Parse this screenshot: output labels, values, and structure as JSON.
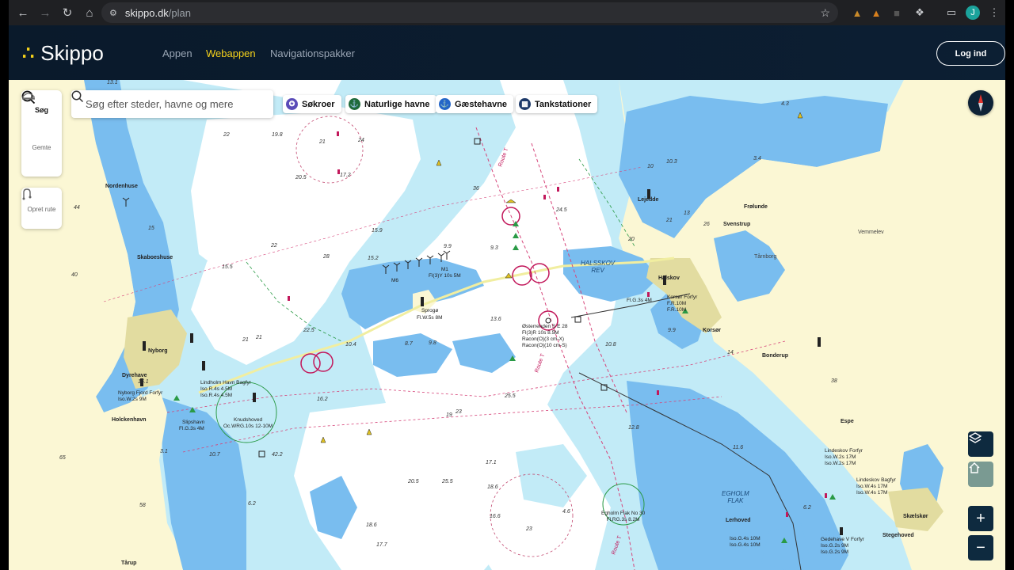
{
  "browser": {
    "url_host": "skippo.dk",
    "url_path": "/plan",
    "profile_initial": "J"
  },
  "header": {
    "logo_text": "Skippo",
    "nav": [
      "Appen",
      "Webappen",
      "Navigationspakker"
    ],
    "login": "Log ind"
  },
  "sidebar": {
    "search": "Søg",
    "saved": "Gemte",
    "create_route": "Opret rute"
  },
  "search": {
    "placeholder": "Søg efter steder, havne og mere"
  },
  "chips": [
    {
      "label": "Søkroer",
      "color": "#5a4bb8"
    },
    {
      "label": "Naturlige havne",
      "color": "#1e6a3a"
    },
    {
      "label": "Gæstehavne",
      "color": "#2466c8"
    },
    {
      "label": "Tankstationer",
      "color": "#1e3a6a"
    }
  ],
  "places": {
    "nordenhuse": "Nordenhuse",
    "skaboeshuse": "Skaboeshuse",
    "nyborg": "Nyborg",
    "dyrehave": "Dyrehave",
    "holckenhavn": "Holckenhavn",
    "tarup": "Tårup",
    "lejedde": "Lejedde",
    "frolunde": "Frølunde",
    "svenstrup": "Svenstrup",
    "vemmelev": "Vemmelev",
    "tarnborg": "Tårnborg",
    "halskov": "Halskov",
    "korsor": "Korsør",
    "bonderup": "Bonderup",
    "espe": "Espe",
    "lerhoved": "Lerhoved",
    "skaelskor": "Skælskør",
    "stegehoved": "Stegehoved",
    "halsskov_rev": "HALSSKOV\nREV",
    "egholm_flak": "EGHOLM\nFLAK",
    "sprogo": "Sprogø",
    "knudshoved": "Knudshoved",
    "slipshavn": "Slipshavn"
  },
  "lights": {
    "m1": "M1\nFl(3)Y 10s 5M",
    "m6": "M6",
    "sprogo_light": "Fl.W.5s 8M",
    "ostrerenden": "Østerrenden S E 28\nFl(3)R 10s 8.5M\nRacon(O)(3 cm-X)\nRacon(O)(10 cm-S)",
    "korsor_forfyr": "Korsør Forfyr\nF.R.10M\nF.R.10M",
    "fl_g_3s": "Fl.G.3s 4M",
    "lindholm": "Lindholm Havn Bagfyr\nIso.R.4s 4.5M\nIso.R.4s 4.5M",
    "nyborg_fjord": "Nyborg Fjord Forfyr\nIso.W.2s 9M",
    "knudshoved_light": "Oc.WRG.10s 12-10M",
    "slipshavn_light": "Fl.G.3s 4M",
    "egholm": "Egholm Flak No 30\nFl.RG.3s 8.2M",
    "lindeskov_forfyr": "Lindeskov Forfyr\nIso.W.2s 17M\nIso.W.2s 17M",
    "lindeskov_bagfyr": "Lindeskov Bagfyr\nIso.W.4s 17M\nIso.W.4s 17M",
    "lerhoved_light": "Iso.G.4s 10M\nIso.G.4s 10M",
    "gedehave": "Gedehave V Forfyr\nIso.G.2s 9M\nIso.G.2s 9M"
  },
  "depths": [
    "13.1",
    "44",
    "15",
    "22",
    "19.8",
    "21",
    "24",
    "17.2",
    "20.5",
    "28",
    "15.5",
    "40",
    "22",
    "21",
    "22.5",
    "21",
    "15.9",
    "15.2",
    "9.9",
    "36",
    "24.5",
    "10",
    "10.3",
    "4.3",
    "3.4",
    "20",
    "21",
    "13",
    "26",
    "9.3",
    "13.6",
    "9.8",
    "8.7",
    "10.4",
    "10.8",
    "9.9",
    "14",
    "38",
    "16.2",
    "19",
    "23",
    "25.5",
    "17.1",
    "20.5",
    "18.6",
    "16.6",
    "23",
    "25.5",
    "4.6",
    "18.6",
    "17.7",
    "12.8",
    "11.6",
    "6.2",
    "10.7",
    "6.2",
    "65",
    "58",
    "3.1",
    "15.1",
    "42.2"
  ],
  "routes": {
    "route_t": "Route T"
  },
  "colors": {
    "land": "#fbf7d4",
    "deep_water": "#ffffff",
    "mid_water": "#c2ebf7",
    "shallow_water": "#79bdef",
    "urban": "#e2dca0",
    "header_bg": "#0b1c2f",
    "accent_yellow": "#f5d21b"
  }
}
